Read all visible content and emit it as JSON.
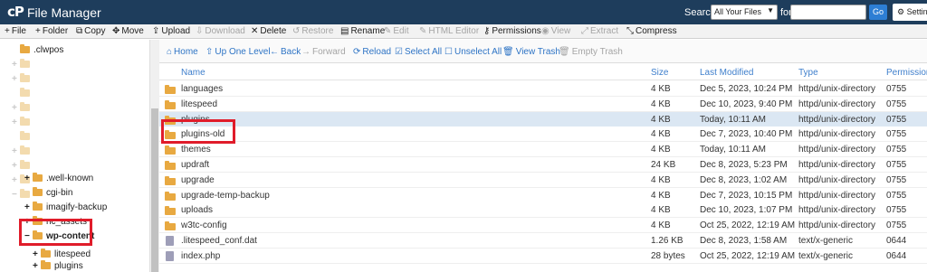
{
  "header": {
    "logo": "cP",
    "title": "File Manager",
    "search_label": "Search",
    "search_scope": "All Your Files",
    "for_label": "for",
    "go_label": "Go",
    "settings_label": "Settings"
  },
  "toolbar": [
    {
      "icon": "plus-icon",
      "glyph": "+",
      "label": "File"
    },
    {
      "icon": "plus-icon",
      "glyph": "+",
      "label": "Folder"
    },
    {
      "icon": "copy-icon",
      "glyph": "⧉",
      "label": "Copy"
    },
    {
      "icon": "move-icon",
      "glyph": "✥",
      "label": "Move"
    },
    {
      "icon": "upload-icon",
      "glyph": "⇪",
      "label": "Upload"
    },
    {
      "icon": "download-icon",
      "glyph": "⇩",
      "label": "Download"
    },
    {
      "icon": "close-icon",
      "glyph": "✕",
      "label": "Delete"
    },
    {
      "icon": "restore-icon",
      "glyph": "↺",
      "label": "Restore"
    },
    {
      "icon": "rename-icon",
      "glyph": "▤",
      "label": "Rename"
    },
    {
      "icon": "edit-icon",
      "glyph": "✎",
      "label": "Edit"
    },
    {
      "icon": "html-editor-icon",
      "glyph": "✎",
      "label": "HTML Editor"
    },
    {
      "icon": "key-icon",
      "glyph": "⚷",
      "label": "Permissions"
    },
    {
      "icon": "eye-icon",
      "glyph": "◉",
      "label": "View"
    },
    {
      "icon": "extract-icon",
      "glyph": "⤢",
      "label": "Extract"
    },
    {
      "icon": "compress-icon",
      "glyph": "⤡",
      "label": "Compress"
    }
  ],
  "nav": [
    {
      "icon": "home-icon",
      "glyph": "⌂",
      "label": "Home"
    },
    {
      "icon": "up-level-icon",
      "glyph": "⇧",
      "label": "Up One Level"
    },
    {
      "icon": "back-icon",
      "glyph": "←",
      "label": "Back"
    },
    {
      "icon": "forward-icon",
      "glyph": "→",
      "label": "Forward"
    },
    {
      "icon": "reload-icon",
      "glyph": "⟳",
      "label": "Reload"
    },
    {
      "icon": "select-all-icon",
      "glyph": "☑",
      "label": "Select All"
    },
    {
      "icon": "unselect-all-icon",
      "glyph": "☐",
      "label": "Unselect All"
    },
    {
      "icon": "trash-icon",
      "glyph": "🗑",
      "label": "View Trash"
    },
    {
      "icon": "trash-icon",
      "glyph": "🗑",
      "label": "Empty Trash"
    }
  ],
  "columns": {
    "name": "Name",
    "size": "Size",
    "modified": "Last Modified",
    "type": "Type",
    "permissions": "Permissions"
  },
  "files": [
    {
      "name": "languages",
      "size": "4 KB",
      "modified": "Dec 5, 2023, 10:24 PM",
      "type": "httpd/unix-directory",
      "perms": "0755",
      "kind": "folder"
    },
    {
      "name": "litespeed",
      "size": "4 KB",
      "modified": "Dec 10, 2023, 9:40 PM",
      "type": "httpd/unix-directory",
      "perms": "0755",
      "kind": "folder"
    },
    {
      "name": "plugins",
      "size": "4 KB",
      "modified": "Today, 10:11 AM",
      "type": "httpd/unix-directory",
      "perms": "0755",
      "kind": "folder"
    },
    {
      "name": "plugins-old",
      "size": "4 KB",
      "modified": "Dec 7, 2023, 10:40 PM",
      "type": "httpd/unix-directory",
      "perms": "0755",
      "kind": "folder"
    },
    {
      "name": "themes",
      "size": "4 KB",
      "modified": "Today, 10:11 AM",
      "type": "httpd/unix-directory",
      "perms": "0755",
      "kind": "folder"
    },
    {
      "name": "updraft",
      "size": "24 KB",
      "modified": "Dec 8, 2023, 5:23 PM",
      "type": "httpd/unix-directory",
      "perms": "0755",
      "kind": "folder"
    },
    {
      "name": "upgrade",
      "size": "4 KB",
      "modified": "Dec 8, 2023, 1:02 AM",
      "type": "httpd/unix-directory",
      "perms": "0755",
      "kind": "folder"
    },
    {
      "name": "upgrade-temp-backup",
      "size": "4 KB",
      "modified": "Dec 7, 2023, 10:15 PM",
      "type": "httpd/unix-directory",
      "perms": "0755",
      "kind": "folder"
    },
    {
      "name": "uploads",
      "size": "4 KB",
      "modified": "Dec 10, 2023, 1:07 PM",
      "type": "httpd/unix-directory",
      "perms": "0755",
      "kind": "folder"
    },
    {
      "name": "w3tc-config",
      "size": "4 KB",
      "modified": "Oct 25, 2022, 12:19 AM",
      "type": "httpd/unix-directory",
      "perms": "0755",
      "kind": "folder"
    },
    {
      "name": ".litespeed_conf.dat",
      "size": "1.26 KB",
      "modified": "Dec 8, 2023, 1:58 AM",
      "type": "text/x-generic",
      "perms": "0644",
      "kind": "file"
    },
    {
      "name": "index.php",
      "size": "28 bytes",
      "modified": "Oct 25, 2022, 12:19 AM",
      "type": "text/x-generic",
      "perms": "0644",
      "kind": "file"
    }
  ],
  "tree": {
    "items": [
      {
        "label": ".clwpos",
        "expander": "",
        "faded": false
      },
      {
        "label": "",
        "expander": "+",
        "faded": true
      },
      {
        "label": "",
        "expander": "+",
        "faded": true
      },
      {
        "label": "",
        "expander": "",
        "faded": true
      },
      {
        "label": "",
        "expander": "+",
        "faded": true
      },
      {
        "label": "",
        "expander": "+",
        "faded": true
      },
      {
        "label": "",
        "expander": "",
        "faded": true
      },
      {
        "label": "",
        "expander": "+",
        "faded": true
      },
      {
        "label": "",
        "expander": "+",
        "faded": true
      },
      {
        "label": "",
        "expander": "",
        "faded": true
      },
      {
        "label": "",
        "expander": "+",
        "faded": true
      },
      {
        "label": "",
        "expander": "−",
        "faded": true
      },
      {
        "label": ".well-known",
        "expander": "+",
        "faded": false
      },
      {
        "label": "cgi-bin",
        "expander": "",
        "faded": false
      },
      {
        "label": "imagify-backup",
        "expander": "+",
        "faded": false
      },
      {
        "label": "nc_assets",
        "expander": "+",
        "faded": false
      },
      {
        "label": "",
        "expander": "+",
        "faded": true
      },
      {
        "label": "wp-content",
        "expander": "−",
        "faded": false,
        "bold": true
      },
      {
        "label": "",
        "expander": "+",
        "faded": true
      },
      {
        "label": "litespeed",
        "expander": "+",
        "faded": false
      },
      {
        "label": "plugins",
        "expander": "+",
        "faded": false
      }
    ]
  },
  "colors": {
    "header_bg": "#1e3d5c",
    "link_blue": "#2e74c5",
    "folder": "#e8a941",
    "highlight_red": "#e01c2a",
    "selected_row": "#dbe7f3"
  }
}
